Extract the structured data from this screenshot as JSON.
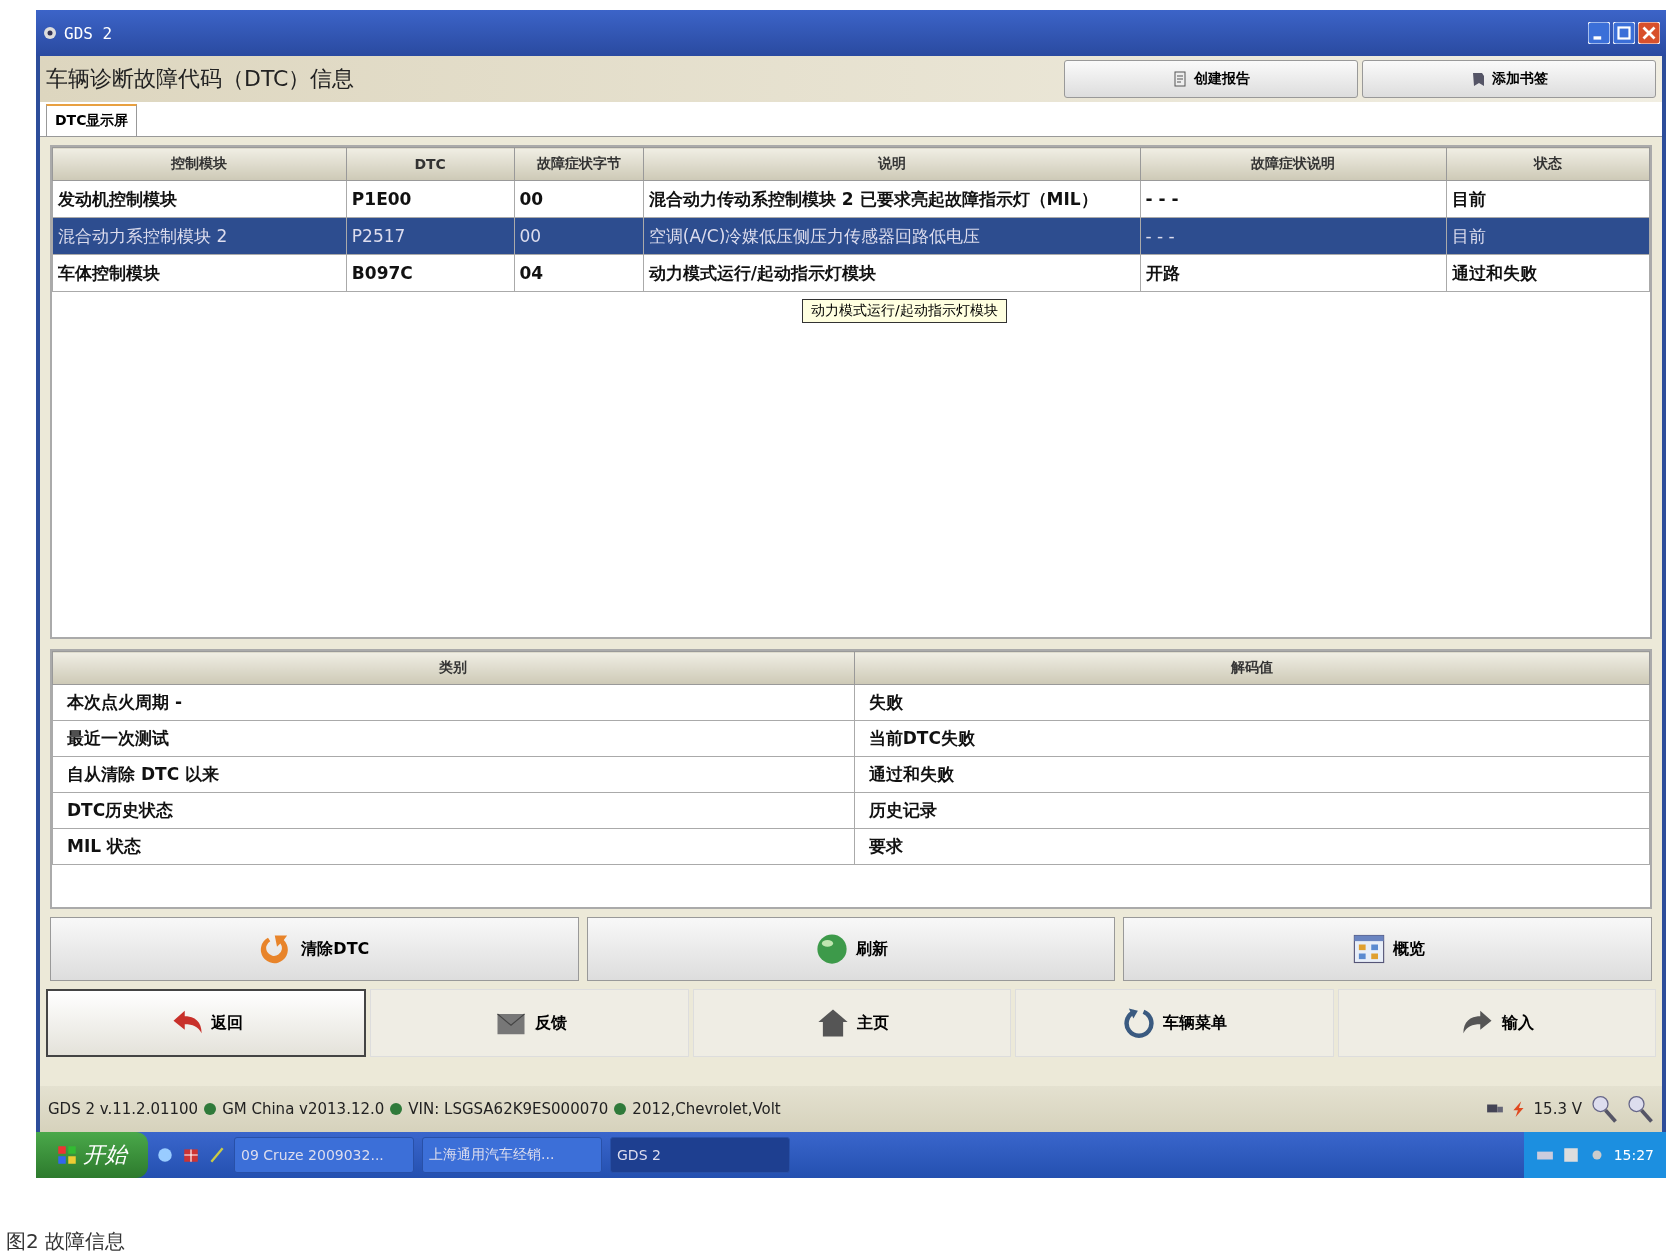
{
  "window": {
    "title": "GDS 2"
  },
  "header": {
    "title": "车辆诊断故障代码（DTC）信息",
    "buttons": [
      {
        "label": "创建报告",
        "kind": "report"
      },
      {
        "label": "添加书签",
        "kind": "bookmark"
      }
    ]
  },
  "tabs": [
    {
      "label": "DTC显示屏",
      "selected": true
    }
  ],
  "dtc_table": {
    "columns": [
      "控制模块",
      "DTC",
      "故障症状字节",
      "说明",
      "故障症状说明",
      "状态"
    ],
    "rows": [
      {
        "cells": [
          "发动机控制模块",
          "P1E00",
          "00",
          "混合动力传动系控制模块 2 已要求亮起故障指示灯（MIL）",
          "- - -",
          "目前"
        ],
        "selected": false
      },
      {
        "cells": [
          "混合动力系控制模块 2",
          "P2517",
          "00",
          "空调(A/C)冷媒低压侧压力传感器回路低电压",
          "- - -",
          "目前"
        ],
        "selected": true
      },
      {
        "cells": [
          "车体控制模块",
          "B097C",
          "04",
          "动力模式运行/起动指示灯模块",
          "开路",
          "通过和失败"
        ],
        "selected": false
      }
    ],
    "tooltip": "动力模式运行/起动指示灯模块"
  },
  "detail_table": {
    "columns": [
      "类别",
      "解码值"
    ],
    "rows": [
      [
        "本次点火周期 -",
        "失败"
      ],
      [
        "最近一次测试",
        "当前DTC失败"
      ],
      [
        "自从清除 DTC 以来",
        "通过和失败"
      ],
      [
        "DTC历史状态",
        "历史记录"
      ],
      [
        "MIL 状态",
        "要求"
      ]
    ]
  },
  "actions": [
    {
      "label": "清除DTC",
      "kind": "clear"
    },
    {
      "label": "刷新",
      "kind": "refresh"
    },
    {
      "label": "概览",
      "kind": "overview"
    }
  ],
  "nav": [
    {
      "label": "返回",
      "kind": "back",
      "focused": true
    },
    {
      "label": "反馈",
      "kind": "feedback",
      "focused": false
    },
    {
      "label": "主页",
      "kind": "home",
      "focused": false
    },
    {
      "label": "车辆菜单",
      "kind": "menu",
      "focused": false
    },
    {
      "label": "输入",
      "kind": "forward",
      "focused": false
    }
  ],
  "status_bar": {
    "items": [
      "GDS 2 v.11.2.01100",
      "GM China v2013.12.0",
      "VIN: LSGSA62K9ES000070",
      "2012,Chevrolet,Volt"
    ],
    "voltage": "15.3 V"
  },
  "taskbar": {
    "start": "开始",
    "tasks": [
      {
        "label": "09 Cruze 2009032...",
        "selected": false
      },
      {
        "label": "上海通用汽车经销...",
        "selected": false
      },
      {
        "label": "GDS 2",
        "selected": true
      }
    ],
    "clock": "15:27"
  },
  "caption": "图2  故障信息"
}
